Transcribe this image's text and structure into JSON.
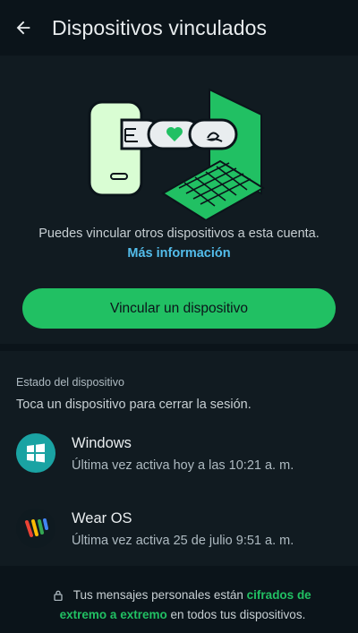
{
  "header": {
    "title": "Dispositivos vinculados",
    "back_icon": "arrow-left-icon"
  },
  "hero": {
    "description_prefix": "Puedes vincular otros dispositivos a esta cuenta.",
    "link_text": "Más información",
    "button_label": "Vincular un dispositivo",
    "illustration_icon": "linked-devices-illustration"
  },
  "devices_section": {
    "title": "Estado del dispositivo",
    "subtitle": "Toca un dispositivo para cerrar la sesión.",
    "items": [
      {
        "name": "Windows",
        "status": "Última vez activa hoy a las 10:21 a. m.",
        "icon": "windows-icon"
      },
      {
        "name": "Wear OS",
        "status": "Última vez activa 25 de julio 9:51 a. m.",
        "icon": "wear-os-icon"
      }
    ]
  },
  "footer": {
    "prefix": "Tus mensajes personales están",
    "emphasis": "cifrados de extremo a extremo",
    "suffix": "en todos tus dispositivos."
  },
  "colors": {
    "background": "#0b141a",
    "panel": "#111b21",
    "accent": "#21c063",
    "link": "#53bdeb"
  }
}
